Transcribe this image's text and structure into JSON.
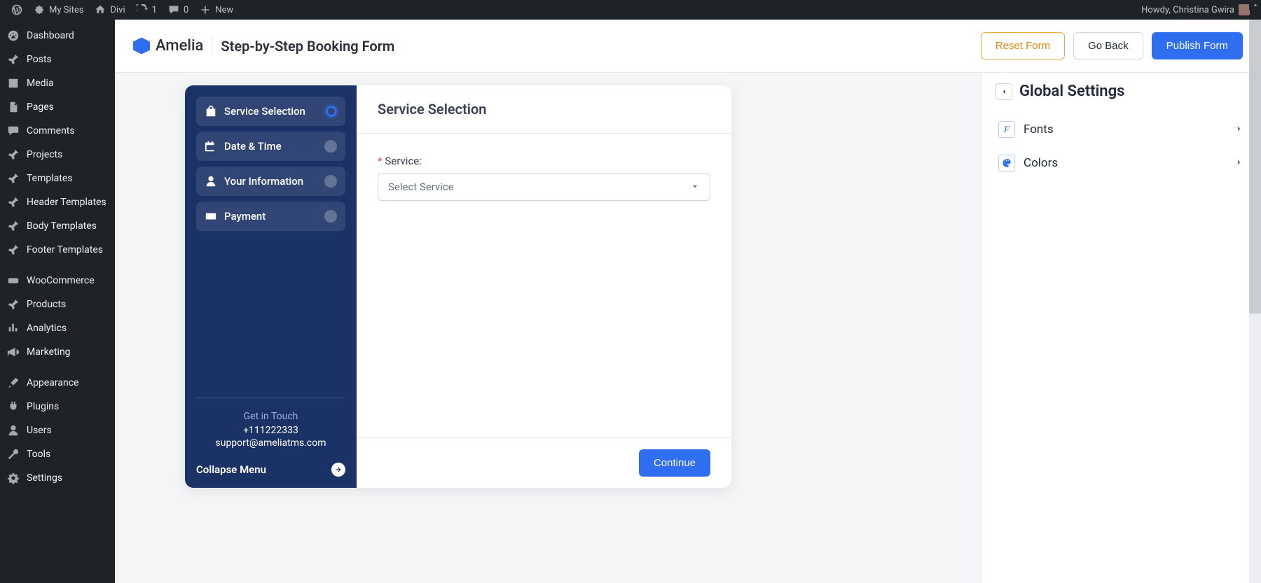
{
  "adminbar": {
    "mysites": "My Sites",
    "site_name": "Divi",
    "updates": "1",
    "comments": "0",
    "new": "New",
    "howdy": "Howdy, Christina Gwira"
  },
  "wp_menu": [
    {
      "icon": "dashboard",
      "label": "Dashboard"
    },
    {
      "icon": "pin",
      "label": "Posts"
    },
    {
      "icon": "media",
      "label": "Media"
    },
    {
      "icon": "pages",
      "label": "Pages"
    },
    {
      "icon": "comment",
      "label": "Comments"
    },
    {
      "icon": "pin",
      "label": "Projects"
    },
    {
      "icon": "pin",
      "label": "Templates"
    },
    {
      "icon": "pin",
      "label": "Header Templates"
    },
    {
      "icon": "pin",
      "label": "Body Templates"
    },
    {
      "icon": "pin",
      "label": "Footer Templates"
    },
    {
      "sep": true
    },
    {
      "icon": "woo",
      "label": "WooCommerce"
    },
    {
      "icon": "pin",
      "label": "Products"
    },
    {
      "icon": "analytics",
      "label": "Analytics"
    },
    {
      "icon": "marketing",
      "label": "Marketing"
    },
    {
      "sep": true
    },
    {
      "icon": "brush",
      "label": "Appearance"
    },
    {
      "icon": "plug",
      "label": "Plugins"
    },
    {
      "icon": "user",
      "label": "Users"
    },
    {
      "icon": "wrench",
      "label": "Tools"
    },
    {
      "icon": "gear",
      "label": "Settings"
    }
  ],
  "header": {
    "brand": "Amelia",
    "page_title": "Step-by-Step Booking Form",
    "reset": "Reset Form",
    "go_back": "Go Back",
    "publish": "Publish Form"
  },
  "booking": {
    "steps": [
      {
        "label": "Service Selection",
        "active": true,
        "icon": "bag"
      },
      {
        "label": "Date & Time",
        "active": false,
        "icon": "calendar"
      },
      {
        "label": "Your Information",
        "active": false,
        "icon": "user"
      },
      {
        "label": "Payment",
        "active": false,
        "icon": "card"
      }
    ],
    "touch_label": "Get in Touch",
    "phone": "+111222333",
    "email": "support@ameliatms.com",
    "collapse": "Collapse Menu",
    "section_title": "Service Selection",
    "field_label": "Service:",
    "select_placeholder": "Select Service",
    "continue": "Continue"
  },
  "settings": {
    "title": "Global Settings",
    "rows": [
      {
        "label": "Fonts",
        "icon": "font"
      },
      {
        "label": "Colors",
        "icon": "palette"
      }
    ]
  }
}
